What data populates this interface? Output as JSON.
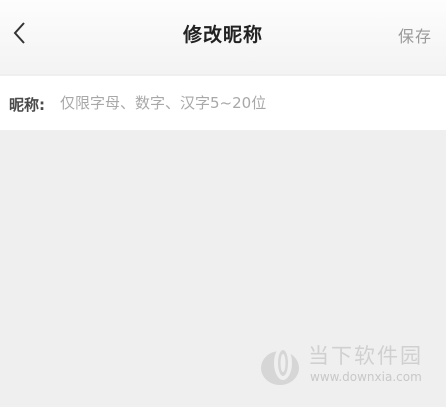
{
  "header": {
    "back_icon": "chevron-left-icon",
    "title": "修改昵称",
    "save_label": "保存"
  },
  "nickname": {
    "label": "昵称:",
    "value": "",
    "placeholder": "仅限字母、数字、汉字5~20位"
  },
  "watermark": {
    "name": "当下软件园",
    "url": "www.downxia.com"
  },
  "colors": {
    "background": "#efefef",
    "title": "#222222",
    "save": "#9a9a9a",
    "placeholder": "#a8a8a8"
  }
}
